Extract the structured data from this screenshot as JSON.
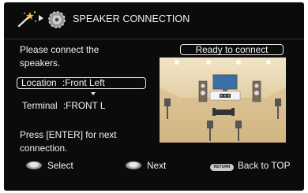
{
  "header": {
    "title": "SPEAKER CONNECTION",
    "icons": [
      "wand-icon",
      "arrow-right-icon",
      "speaker-setup-icon"
    ]
  },
  "instruction": {
    "line1": "Please connect the",
    "line2": "speakers."
  },
  "location": {
    "label": "Location",
    "value": ":Front Left"
  },
  "terminal": {
    "label": "Terminal",
    "value": ":FRONT L"
  },
  "status": {
    "text": "Ready to connect"
  },
  "hint": {
    "line1": "Press [ENTER] for next",
    "line2": "connection."
  },
  "footer": {
    "select_label": "Select",
    "next_label": "Next",
    "return_button_text": "RETURN",
    "back_label": "Back to TOP"
  },
  "colors": {
    "screen_background": "#0b0b0b",
    "text": "#f2f2f2",
    "room_wall": "#e9d9b6",
    "room_floor": "#dcc49a"
  }
}
